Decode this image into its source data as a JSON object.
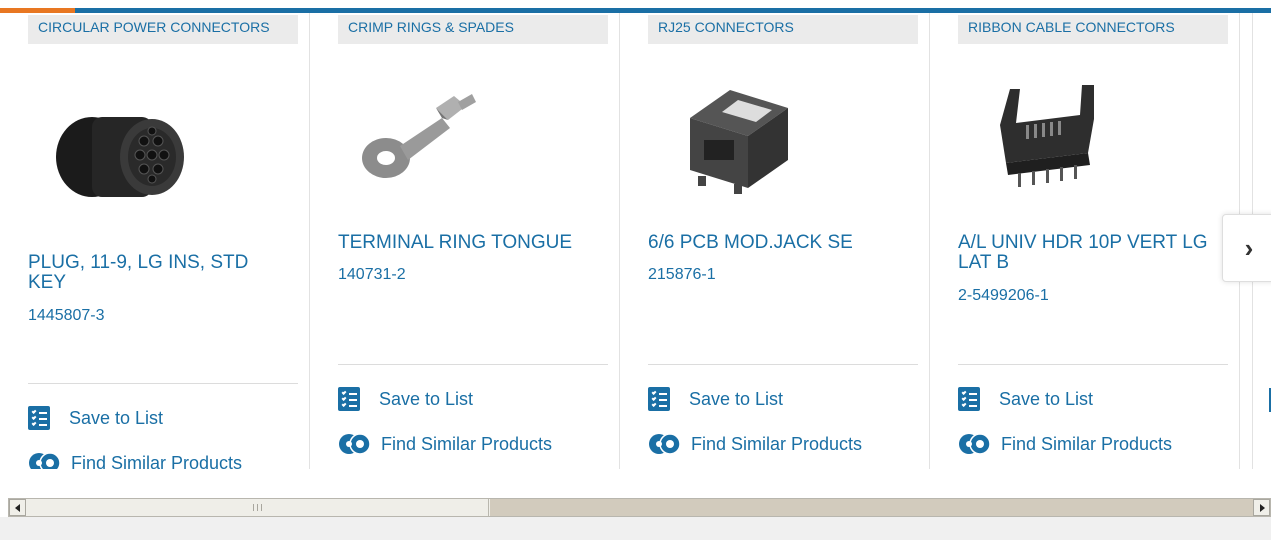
{
  "cards": [
    {
      "category": "CIRCULAR POWER CONNECTORS",
      "title": "PLUG, 11-9, LG INS, STD KEY",
      "part_number": "1445807-3",
      "save_label": "Save to List",
      "find_label": "Find Similar Products"
    },
    {
      "category": "CRIMP RINGS & SPADES",
      "title": "TERMINAL RING TONGUE",
      "part_number": "140731-2",
      "save_label": "Save to List",
      "find_label": "Find Similar Products"
    },
    {
      "category": "RJ25 CONNECTORS",
      "title": "6/6 PCB MOD.JACK SE",
      "part_number": "215876-1",
      "save_label": "Save to List",
      "find_label": "Find Similar Products"
    },
    {
      "category": "RIBBON CABLE CONNECTORS",
      "title": "A/L UNIV HDR 10P VERT LG LAT B",
      "part_number": "2-5499206-1",
      "save_label": "Save to List",
      "find_label": "Find Similar Products"
    }
  ],
  "next_button": {
    "glyph": "›",
    "icon": "chevron-right-icon"
  },
  "colors": {
    "link_blue": "#1a6fa5",
    "accent_orange": "#e87722",
    "category_bg": "#ebebeb"
  },
  "scrollbar": {
    "position": 0.0
  }
}
